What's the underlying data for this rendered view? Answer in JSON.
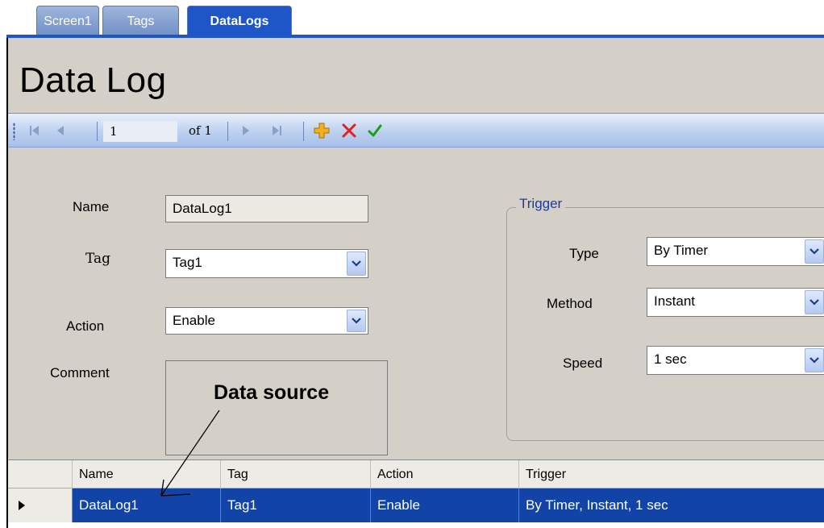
{
  "tabs": [
    {
      "label": "Screen1",
      "active": false
    },
    {
      "label": "Tags",
      "active": false
    },
    {
      "label": "DataLogs",
      "active": true
    }
  ],
  "page": {
    "title": "Data Log"
  },
  "navigator": {
    "position": "1",
    "count_label": "of 1",
    "icons": [
      "move-first-icon",
      "move-previous-icon",
      "move-next-icon",
      "move-last-icon",
      "add-new-icon",
      "delete-icon",
      "save-icon"
    ]
  },
  "form": {
    "name_label": "Name",
    "name_value": "DataLog1",
    "tag_label": "Tag",
    "tag_value": "Tag1",
    "action_label": "Action",
    "action_value": "Enable",
    "comment_label": "Comment",
    "comment_value": ""
  },
  "trigger": {
    "group_title": "Trigger",
    "type_label": "Type",
    "type_value": "By Timer",
    "method_label": "Method",
    "method_value": "Instant",
    "speed_label": "Speed",
    "speed_value": "1 sec"
  },
  "annotation": {
    "text": "Data source"
  },
  "grid": {
    "columns": [
      "Name",
      "Tag",
      "Action",
      "Trigger"
    ],
    "rows": [
      {
        "name": "DataLog1",
        "tag": "Tag1",
        "action": "Enable",
        "trigger": "By Timer, Instant, 1 sec"
      }
    ]
  },
  "colors": {
    "accent": "#1e56c8",
    "selection": "#1244a8",
    "panel": "#d4d0c8",
    "add_icon": "#f0b020",
    "delete_icon": "#e02020",
    "save_icon": "#18a018"
  }
}
